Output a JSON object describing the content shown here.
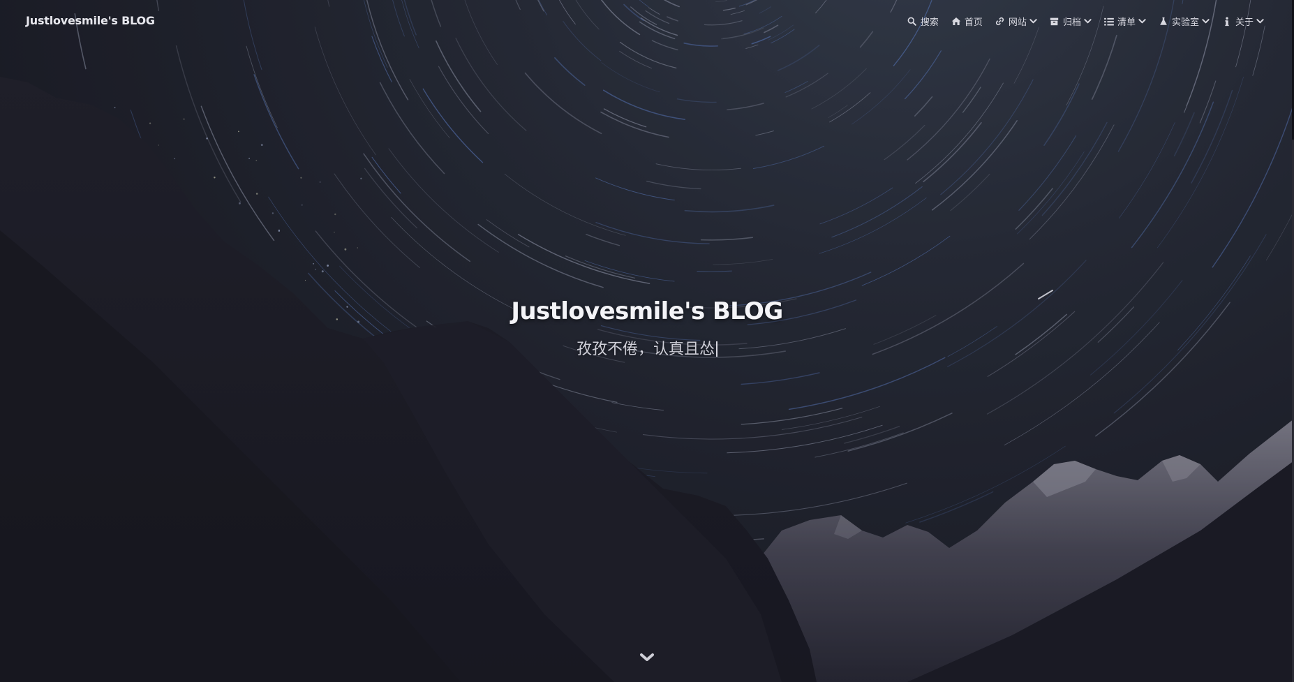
{
  "navbar": {
    "brand": "Justlovesmile's BLOG",
    "items": [
      {
        "label": "搜索",
        "icon": "search-icon",
        "has_dropdown": false
      },
      {
        "label": "首页",
        "icon": "home-icon",
        "has_dropdown": false
      },
      {
        "label": "网站",
        "icon": "link-icon",
        "has_dropdown": true
      },
      {
        "label": "归档",
        "icon": "archive-icon",
        "has_dropdown": true
      },
      {
        "label": "清单",
        "icon": "list-icon",
        "has_dropdown": true
      },
      {
        "label": "实验室",
        "icon": "flask-icon",
        "has_dropdown": true
      },
      {
        "label": "关于",
        "icon": "info-icon",
        "has_dropdown": true
      }
    ]
  },
  "hero": {
    "title": "Justlovesmile's BLOG",
    "subtitle": "孜孜不倦，认真且怂",
    "scroll_icon": "chevron-down-icon"
  },
  "colors": {
    "text_primary": "#f4f4f8",
    "text_secondary": "#cfcfd8",
    "background": "#1b1b24"
  }
}
